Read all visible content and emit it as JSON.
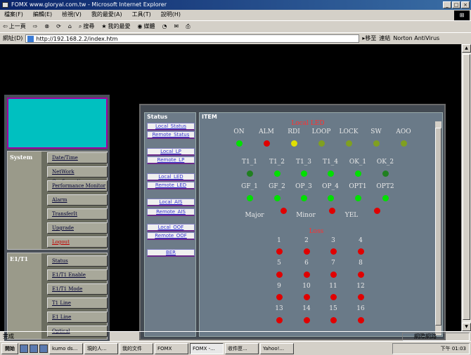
{
  "window": {
    "title": "FOMX www.gloryal.com.tw - Microsoft Internet Explorer"
  },
  "menu": [
    "檔案(F)",
    "編輯(E)",
    "檢視(V)",
    "我的最愛(A)",
    "工具(T)",
    "說明(H)"
  ],
  "toolbar": {
    "back": "上一頁",
    "search": "搜尋",
    "favorites": "我的最愛",
    "media": "媒體"
  },
  "address": {
    "label": "網址(D)",
    "url": "http://192.168.2.2/index.htm",
    "go": "移至",
    "links": "連結",
    "norton": "Norton AntiVirus"
  },
  "sidebar": {
    "system_label": "System",
    "system_items": [
      "Date/Time",
      "NetWork Configuration",
      "Performance Monitor",
      "Alarm",
      "TransferIt",
      "Upgrade",
      "Logout"
    ],
    "e1t1_label": "E1/T1",
    "e1t1_items": [
      "Status",
      "E1/T1 Enable",
      "E1/T1 Mode",
      "T1 Line",
      "E1 Line",
      "Optical"
    ]
  },
  "status_panel": {
    "header": "Status",
    "buttons": [
      "Local_Status",
      "Remote_Status",
      "Local_LP",
      "Remote_LP",
      "Local_LED",
      "Remote_LED",
      "Local_AIS",
      "Remote_AIS",
      "Local_OOF",
      "Remote_OOF",
      "BER"
    ]
  },
  "item_panel": {
    "header": "ITEM",
    "title": "Local LED",
    "row1": [
      {
        "label": "ON",
        "state": "green"
      },
      {
        "label": "ALM",
        "state": "red"
      },
      {
        "label": "RDI",
        "state": "yellow"
      },
      {
        "label": "LOOP",
        "state": "olive"
      },
      {
        "label": "LOCK",
        "state": "olive"
      },
      {
        "label": "SW",
        "state": "olive"
      },
      {
        "label": "AOO",
        "state": "olive"
      }
    ],
    "row2": [
      {
        "label": "T1_1",
        "state": "darkgreen"
      },
      {
        "label": "T1_2",
        "state": "green"
      },
      {
        "label": "T1_3",
        "state": "green"
      },
      {
        "label": "T1_4",
        "state": "green"
      },
      {
        "label": "OK_1",
        "state": "green"
      },
      {
        "label": "OK_2",
        "state": "darkgreen"
      }
    ],
    "row3": [
      {
        "label": "GF_1",
        "state": "green"
      },
      {
        "label": "GF_2",
        "state": "green"
      },
      {
        "label": "OP_3",
        "state": "green"
      },
      {
        "label": "OP_4",
        "state": "green"
      },
      {
        "label": "OPT1",
        "state": "green"
      },
      {
        "label": "OPT2",
        "state": "green"
      }
    ],
    "alarms": [
      {
        "label": "Major",
        "state": "red"
      },
      {
        "label": "Minor",
        "state": "red"
      },
      {
        "label": "YEL",
        "state": "red"
      }
    ],
    "loss_title": "Loss",
    "loss": [
      "1",
      "2",
      "3",
      "4",
      "5",
      "6",
      "7",
      "8",
      "9",
      "10",
      "11",
      "12",
      "13",
      "14",
      "15",
      "16"
    ]
  },
  "statusbar": {
    "text": "完成",
    "zone": "網際網路"
  },
  "taskbar": {
    "start": "開始",
    "tasks": [
      "kumo ds...",
      "現的人...",
      "我的文件",
      "FOMX",
      "FOMX -...",
      "收件匣...",
      "Yahoo!..."
    ],
    "clock": "下午 01:03"
  },
  "colors": {
    "green": "#00e000",
    "darkgreen": "#208020",
    "red": "#e00000",
    "yellow": "#e0e000",
    "olive": "#80a020"
  }
}
